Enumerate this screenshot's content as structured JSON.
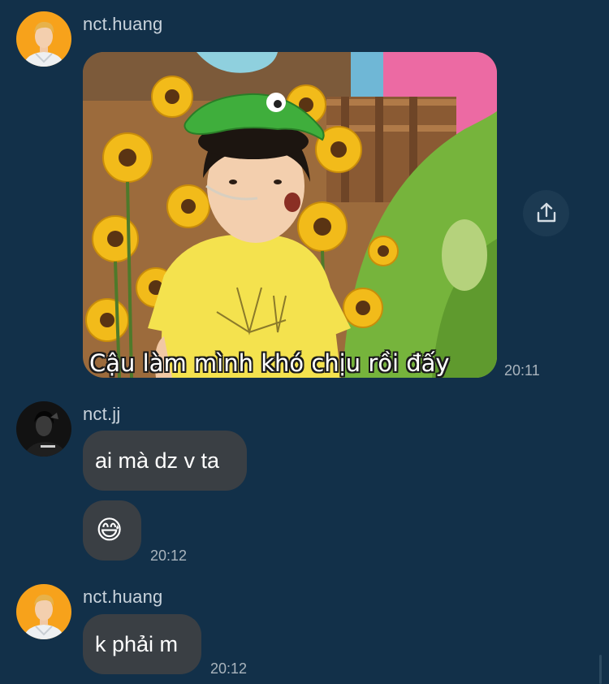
{
  "messages": [
    {
      "sender": "nct.huang",
      "type": "image",
      "image_caption": "Cậu làm mình khó chịu rồi đấy",
      "time": "20:11"
    },
    {
      "sender": "nct.jj",
      "type": "text",
      "text": "ai mà dz v ta"
    },
    {
      "sender": "nct.jj",
      "type": "emoji",
      "emoji": "😅",
      "time": "20:12"
    },
    {
      "sender": "nct.huang",
      "type": "text",
      "text": "k phải m",
      "time": "20:12"
    }
  ],
  "icons": {
    "share": "share-icon"
  },
  "colors": {
    "background": "#123049",
    "bubble": "#3a3f44",
    "sender_text": "#c9d3dc",
    "time_text": "#a9b4bd",
    "huang_avatar_bg": "#f7a21b"
  }
}
